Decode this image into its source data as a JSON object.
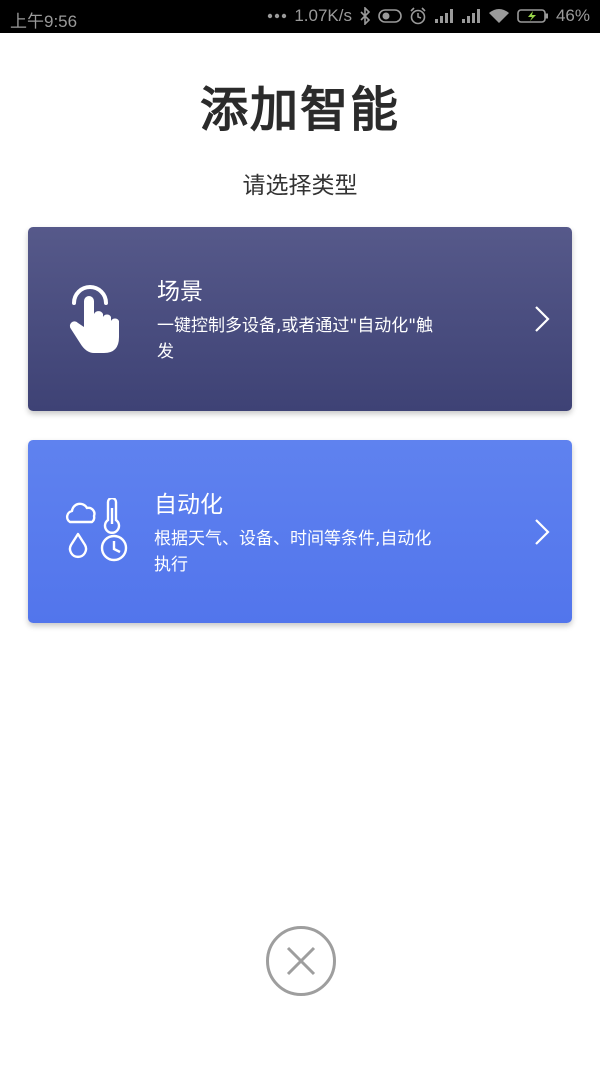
{
  "status_bar": {
    "time": "上午9:56",
    "network_speed": "1.07K/s",
    "battery": "46%"
  },
  "page": {
    "title": "添加智能",
    "subtitle": "请选择类型"
  },
  "cards": [
    {
      "title": "场景",
      "description": "一键控制多设备,或者通过\"自动化\"触发",
      "icon": "tap-hand-icon"
    },
    {
      "title": "自动化",
      "description": "根据天气、设备、时间等条件,自动化执行",
      "icon": "weather-conditions-icon"
    }
  ],
  "close_icon": "close-icon"
}
